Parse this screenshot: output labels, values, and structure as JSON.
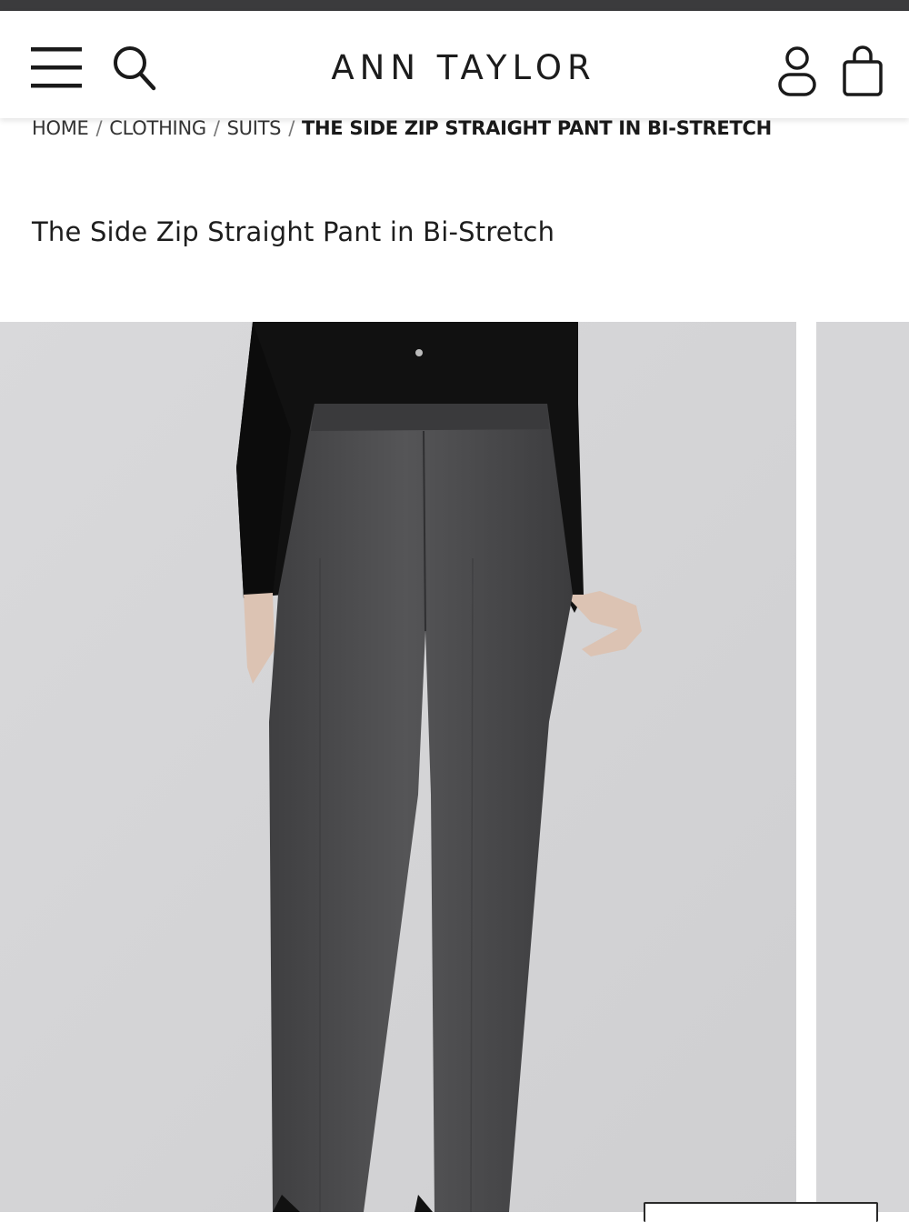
{
  "header": {
    "brand": "ANN TAYLOR",
    "icons": {
      "menu": "menu-icon",
      "search": "search-icon",
      "account": "account-icon",
      "bag": "shopping-bag-icon"
    }
  },
  "breadcrumb": {
    "items": [
      "HOME",
      "CLOTHING",
      "SUITS"
    ],
    "separator": "/",
    "current": "THE SIDE ZIP STRAIGHT PANT IN BI-STRETCH"
  },
  "product": {
    "title": "The Side Zip Straight Pant in Bi-Stretch"
  },
  "colors": {
    "status_bar": "#3b3b3d",
    "image_background": "#d6d6d8",
    "pant": "#4a4a4c",
    "shirt": "#121212"
  }
}
